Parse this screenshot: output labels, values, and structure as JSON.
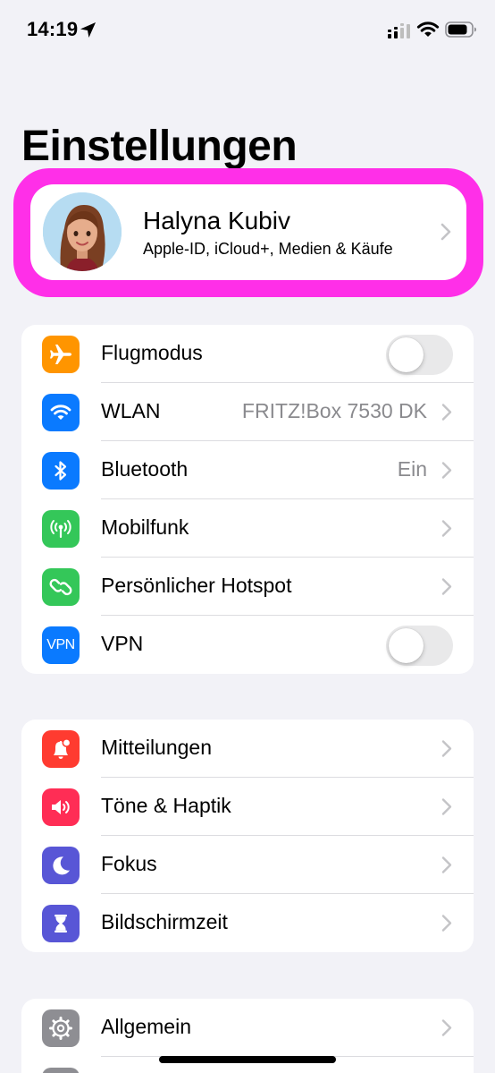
{
  "status_bar": {
    "time": "14:19",
    "icons": [
      "location-arrow-icon",
      "cellular-signal-icon",
      "wifi-icon",
      "battery-icon"
    ]
  },
  "title": "Einstellungen",
  "profile": {
    "name": "Halyna Kubiv",
    "subtitle": "Apple-ID, iCloud+, Medien & Käufe",
    "highlight_color": "#ff2fe8"
  },
  "groups": [
    {
      "rows": [
        {
          "label": "Flugmodus",
          "icon": "airplane-icon",
          "icon_color": "#ff9500",
          "toggle": false
        },
        {
          "label": "WLAN",
          "icon": "wifi-icon",
          "icon_color": "#0a7aff",
          "value": "FRITZ!Box 7530 DK"
        },
        {
          "label": "Bluetooth",
          "icon": "bluetooth-icon",
          "icon_color": "#0a7aff",
          "value": "Ein"
        },
        {
          "label": "Mobilfunk",
          "icon": "antenna-icon",
          "icon_color": "#34c759"
        },
        {
          "label": "Persönlicher Hotspot",
          "icon": "hotspot-icon",
          "icon_color": "#34c759"
        },
        {
          "label": "VPN",
          "icon": "vpn-icon",
          "icon_text": "VPN",
          "icon_color": "#0a7aff",
          "toggle": false
        }
      ]
    },
    {
      "rows": [
        {
          "label": "Mitteilungen",
          "icon": "notifications-icon",
          "icon_color": "#ff3b30"
        },
        {
          "label": "Töne & Haptik",
          "icon": "speaker-icon",
          "icon_color": "#ff2d55"
        },
        {
          "label": "Fokus",
          "icon": "moon-icon",
          "icon_color": "#5856d6"
        },
        {
          "label": "Bildschirmzeit",
          "icon": "hourglass-icon",
          "icon_color": "#5856d6"
        }
      ]
    },
    {
      "rows": [
        {
          "label": "Allgemein",
          "icon": "gear-icon",
          "icon_color": "#8e8e93"
        }
      ]
    }
  ]
}
